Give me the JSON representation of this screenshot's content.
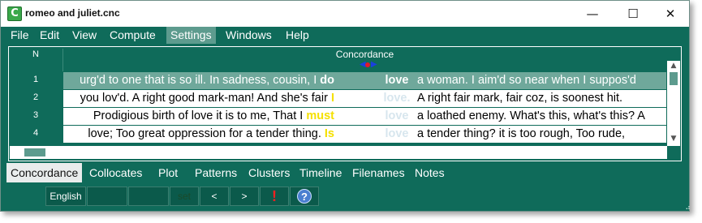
{
  "window": {
    "title": "romeo and juliet.cnc",
    "app_icon_letter": "C",
    "controls": {
      "minimize": "—",
      "maximize": "☐",
      "close": "✕"
    }
  },
  "menu": [
    "File",
    "Edit",
    "View",
    "Compute",
    "Settings",
    "Windows",
    "Help"
  ],
  "menu_active": "Settings",
  "grid": {
    "headers": {
      "n": "N",
      "concordance": "Concordance"
    },
    "rows": [
      {
        "n": "1",
        "left": "urg'd to one that is so ill. In sadness, cousin, I",
        "l1": "do",
        "node": "love",
        "right": "a woman. I aim'd so near when I suppos'd",
        "selected": true
      },
      {
        "n": "2",
        "left": "you lov'd. A right good mark-man! And she's fair",
        "l1": "I",
        "node": "love.",
        "right": "A right fair mark, fair coz, is soonest hit.",
        "selected": false
      },
      {
        "n": "3",
        "left": "Prodigious birth of love it is to me, That I",
        "l1": "must",
        "node": "love",
        "right": "a loathed enemy. What's this, what's this? A",
        "selected": false
      },
      {
        "n": "4",
        "left": "love; Too great oppression for a tender thing.",
        "l1": "Is",
        "node": "love",
        "right": "a tender thing? it is too rough, Too rude,",
        "selected": false
      }
    ]
  },
  "tabs": [
    "Concordance",
    "Collocates",
    "Plot",
    "Patterns",
    "Clusters",
    "Timeline",
    "Filenames",
    "Notes"
  ],
  "tab_active": "Concordance",
  "status": {
    "language": "English",
    "set_label": "set",
    "prev": "<",
    "next": ">",
    "alert": "!",
    "help": "?"
  }
}
